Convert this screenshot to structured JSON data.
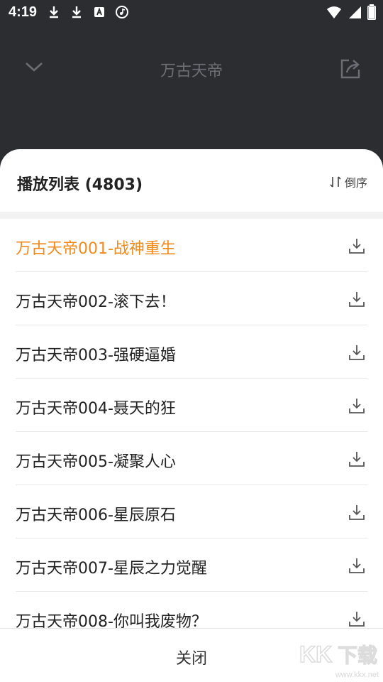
{
  "status_bar": {
    "time": "4:19",
    "icons": [
      "download-icon",
      "download-icon",
      "font-a-icon",
      "music-icon"
    ],
    "right_icons": [
      "wifi-icon",
      "signal-icon",
      "battery-icon"
    ]
  },
  "top_bar": {
    "title": "万古天帝",
    "back_icon": "chevron-down-icon",
    "share_icon": "share-icon"
  },
  "playlist": {
    "title": "播放列表",
    "count": "(4803)",
    "sort_label": "倒序",
    "sort_icon": "sort-icon",
    "items": [
      {
        "label": "万古天帝001-战神重生",
        "active": true
      },
      {
        "label": "万古天帝002-滚下去！",
        "active": false
      },
      {
        "label": "万古天帝003-强硬逼婚",
        "active": false
      },
      {
        "label": "万古天帝004-聂天的狂",
        "active": false
      },
      {
        "label": "万古天帝005-凝聚人心",
        "active": false
      },
      {
        "label": "万古天帝006-星辰原石",
        "active": false
      },
      {
        "label": "万古天帝007-星辰之力觉醒",
        "active": false
      },
      {
        "label": "万古天帝008-你叫我废物？",
        "active": false
      }
    ],
    "close_label": "关闭"
  },
  "colors": {
    "dark_bg": "#2b2d31",
    "accent": "#f08a1c",
    "text": "#222222"
  },
  "watermark": {
    "text": "www.kkx.net"
  }
}
